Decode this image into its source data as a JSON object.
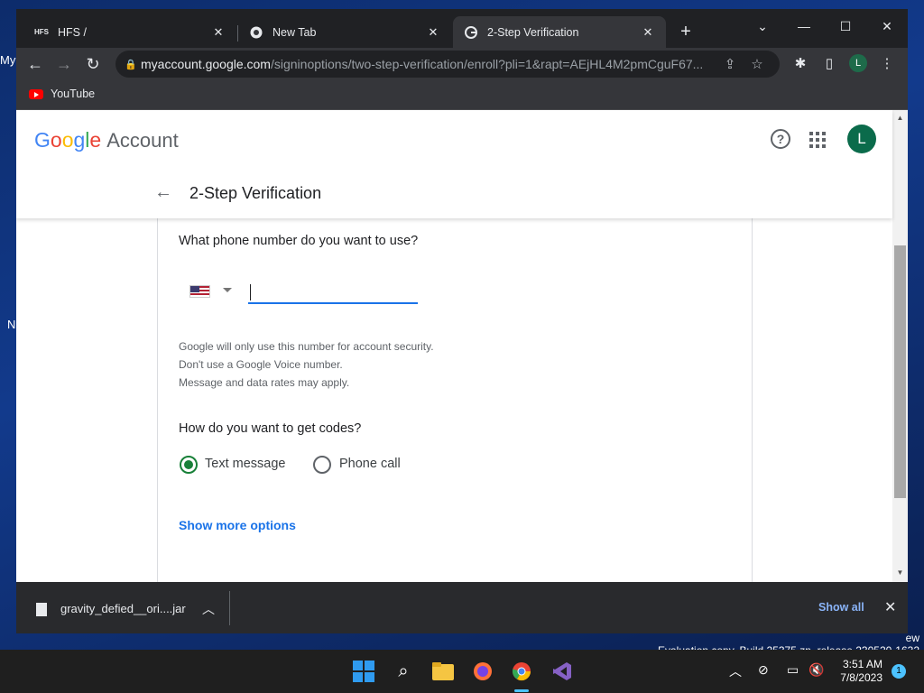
{
  "browser": {
    "tabs": [
      {
        "label": "HFS /",
        "favicon": "hfs-icon"
      },
      {
        "label": "New Tab",
        "favicon": "chrome-icon"
      },
      {
        "label": "2-Step Verification",
        "favicon": "google-icon",
        "active": true
      }
    ],
    "url_domain": "myaccount.google.com",
    "url_path": "/signinoptions/two-step-verification/enroll?pli=1&rapt=AEjHL4M2pmCguF67...",
    "profile_initial": "L",
    "bookmarks": [
      {
        "label": "YouTube"
      }
    ]
  },
  "page": {
    "logo": {
      "google": [
        "G",
        "o",
        "o",
        "g",
        "l",
        "e"
      ],
      "account": "Account"
    },
    "avatar_initial": "L",
    "title": "2-Step Verification",
    "phone_question": "What phone number do you want to use?",
    "phone_value": "",
    "country": "United States",
    "notes": [
      "Google will only use this number for account security.",
      "Don't use a Google Voice number.",
      "Message and data rates may apply."
    ],
    "codes_question": "How do you want to get codes?",
    "options": [
      {
        "label": "Text message",
        "selected": true
      },
      {
        "label": "Phone call",
        "selected": false
      }
    ],
    "more_options": "Show more options"
  },
  "downloads": {
    "file": "gravity_defied__ori....jar",
    "show_all": "Show all"
  },
  "desktop": {
    "stub_labels": [
      "My",
      "N"
    ],
    "eval_line1": "ew",
    "eval_line2": "Evaluation copy. Build 25375.zn_release.230520-1632"
  },
  "taskbar": {
    "time": "3:51 AM",
    "date": "7/8/2023",
    "notification_count": "1"
  },
  "colors": {
    "accent": "#1a73e8",
    "radio_selected": "#188038",
    "avatar": "#0b6b4b"
  }
}
